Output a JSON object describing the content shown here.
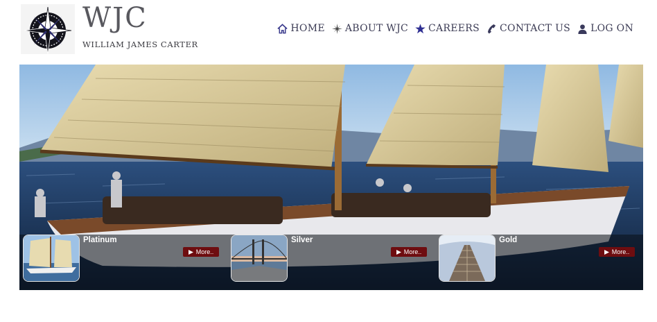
{
  "brand": {
    "title": "WJC",
    "subtitle": "WILLIAM JAMES CARTER"
  },
  "nav": [
    {
      "label": "HOME",
      "icon": "home-icon"
    },
    {
      "label": "ABOUT WJC",
      "icon": "compass-star-icon"
    },
    {
      "label": "CAREERS",
      "icon": "star-icon"
    },
    {
      "label": "CONTACT US",
      "icon": "phone-icon"
    },
    {
      "label": "LOG ON",
      "icon": "user-icon"
    }
  ],
  "slides": [
    {
      "title": "Platinum",
      "more": "More..",
      "thumb": "sailboat-thumbnail"
    },
    {
      "title": "Silver",
      "more": "More..",
      "thumb": "bridge-thumbnail"
    },
    {
      "title": "Gold",
      "more": "More..",
      "thumb": "skyscraper-thumbnail"
    }
  ],
  "colors": {
    "nav_text": "#3c3c55",
    "button_bg": "#6e0d10",
    "nav_icon": "#3a3a8c"
  }
}
